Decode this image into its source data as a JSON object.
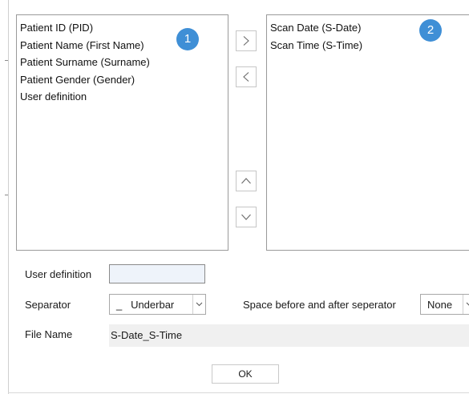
{
  "available_fields": {
    "badge": "1",
    "items": [
      "Patient ID (PID)",
      "Patient Name (First Name)",
      "Patient Surname (Surname)",
      "Patient Gender (Gender)",
      "User definition"
    ]
  },
  "selected_fields": {
    "badge": "2",
    "items": [
      "Scan Date (S-Date)",
      "Scan Time (S-Time)"
    ]
  },
  "transfer_buttons": {
    "move_right_icon": "chevron-right-icon",
    "move_left_icon": "chevron-left-icon",
    "move_up_icon": "chevron-up-icon",
    "move_down_icon": "chevron-down-icon"
  },
  "form": {
    "user_definition_label": "User definition",
    "user_definition_value": "",
    "separator_label": "Separator",
    "separator_value": "_   Underbar",
    "space_label": "Space before and after seperator",
    "space_value": "None",
    "file_name_label": "File Name",
    "file_name_value": "S-Date_S-Time"
  },
  "ok_label": "OK",
  "colors": {
    "badge": "#3f8fd6",
    "border": "#9a9a9a",
    "input_bg": "#eef3fa",
    "readonly_bg": "#f0f0f0"
  }
}
